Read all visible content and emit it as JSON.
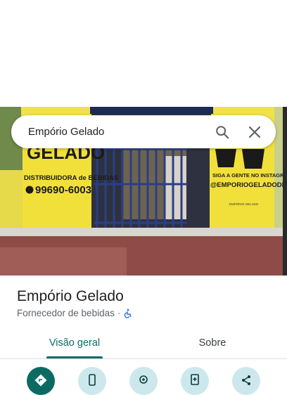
{
  "search": {
    "query": "Empório Gelado"
  },
  "place": {
    "name": "Empório Gelado",
    "category": "Fornecedor de bebidas",
    "separator": "·"
  },
  "tabs": [
    {
      "label": "Visão geral",
      "active": true
    },
    {
      "label": "Sobre",
      "active": false
    }
  ],
  "photo_signage": {
    "left_sign_brand": "GELADO",
    "left_sign_sub": "DISTRIBUIDORA de BEBIDAS",
    "left_sign_phone": "99690-6003",
    "right_sign_line1": "SIGA A GENTE NO INSTAGRAM",
    "right_sign_handle": "@EMPORIOGELADODF",
    "right_sign_small": "EMPÓRIO GELADO"
  },
  "colors": {
    "accent": "#0b6b63",
    "action_bg": "#cde8ec",
    "sign_yellow": "#f2e03a",
    "floor_red": "#8e4b47"
  },
  "icons": {
    "search": "search-icon",
    "close": "close-icon",
    "accessibility": "wheelchair-icon",
    "actions": [
      "directions-icon",
      "phone-icon",
      "location-icon",
      "save-icon",
      "share-icon"
    ]
  }
}
